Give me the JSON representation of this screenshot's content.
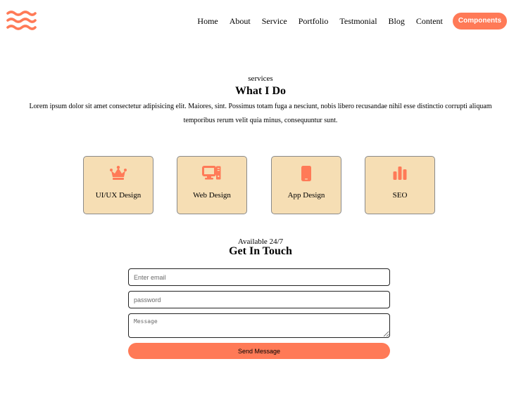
{
  "brand": {
    "accent": "#ff7a57",
    "card_bg": "#f6deb4",
    "icon": "wave-logo-icon"
  },
  "nav": {
    "items": [
      "Home",
      "About",
      "Service",
      "Portfolio",
      "Testmonial",
      "Blog",
      "Content"
    ],
    "cta": "Components"
  },
  "services": {
    "eyebrow": "services",
    "title": "What I Do",
    "description": "Lorem ipsum dolor sit amet consectetur adipisicing elit. Maiores, sint. Possimus totam fuga a nesciunt, nobis libero recusandae nihil esse distinctio corrupti aliquam temporibus rerum velit quia minus, consequuntur sunt.",
    "cards": [
      {
        "label": "UI/UX Design",
        "icon": "crown-icon"
      },
      {
        "label": "Web Design",
        "icon": "desktop-computer-icon"
      },
      {
        "label": "App Design",
        "icon": "mobile-phone-icon"
      },
      {
        "label": "SEO",
        "icon": "bar-chart-icon"
      }
    ]
  },
  "contact": {
    "eyebrow": "Available 24/7",
    "title": "Get In Touch",
    "email_placeholder": "Enter email",
    "password_placeholder": "password",
    "message_placeholder": "Message",
    "submit_label": "Send Message"
  }
}
